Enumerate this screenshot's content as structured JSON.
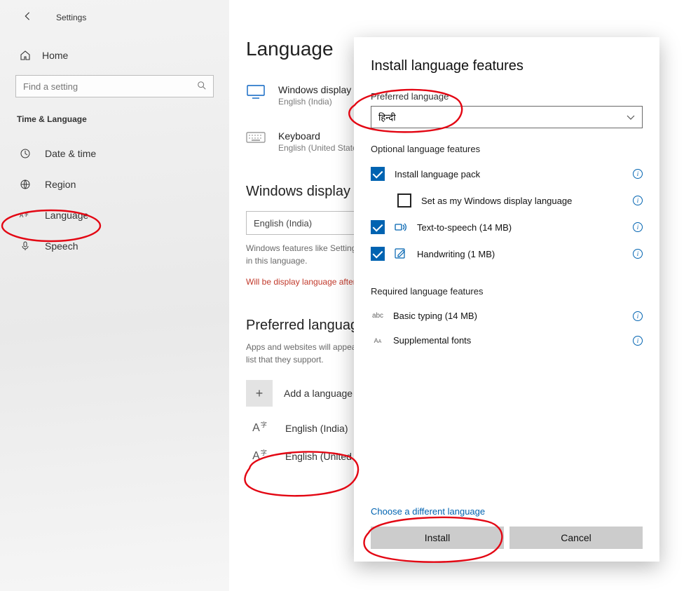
{
  "header": {
    "settings_label": "Settings"
  },
  "sidebar": {
    "home_label": "Home",
    "search_placeholder": "Find a setting",
    "section_title": "Time & Language",
    "items": [
      {
        "label": "Date & time"
      },
      {
        "label": "Region"
      },
      {
        "label": "Language"
      },
      {
        "label": "Speech"
      }
    ]
  },
  "page": {
    "title": "Language",
    "tile_display": {
      "title": "Windows display",
      "sub": "English (India)"
    },
    "tile_keyboard": {
      "title": "Keyboard",
      "sub": "English (United States)"
    },
    "section_display": "Windows display language",
    "combo_value": "English (India)",
    "muted_text": "Windows features like Settings and File Explorer will appear in this language.",
    "red_text": "Will be display language after next sign-in",
    "section_preferred": "Preferred languages",
    "preferred_desc": "Apps and websites will appear in the first language in the list that they support.",
    "add_label": "Add a language",
    "langs": [
      {
        "label": "English (India)"
      },
      {
        "label": "English (United States)"
      }
    ]
  },
  "dialog": {
    "title": "Install language features",
    "preferred_label": "Preferred language",
    "selected_language": "हिन्दी",
    "optional_header": "Optional language features",
    "options": [
      {
        "label": "Install language pack"
      },
      {
        "label": "Set as my Windows display language"
      },
      {
        "label": "Text-to-speech (14 MB)"
      },
      {
        "label": "Handwriting (1 MB)"
      }
    ],
    "required_header": "Required language features",
    "required": [
      {
        "label": "Basic typing (14 MB)"
      },
      {
        "label": "Supplemental fonts"
      }
    ],
    "choose_link": "Choose a different language",
    "install_label": "Install",
    "cancel_label": "Cancel"
  }
}
